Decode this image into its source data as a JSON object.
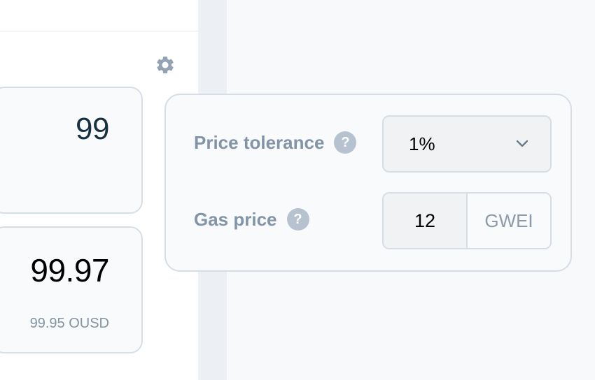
{
  "swap_form": {
    "settings_icon": "gear-icon",
    "input_amount": "99",
    "output_amount": "99.97",
    "output_min": "99.95 OUSD"
  },
  "settings": {
    "price_tolerance": {
      "label": "Price tolerance",
      "help_icon": "?",
      "selected": "1%"
    },
    "gas_price": {
      "label": "Gas price",
      "help_icon": "?",
      "value": "12",
      "unit": "GWEI"
    }
  },
  "colors": {
    "label": "#8394a8",
    "border": "#d6dde4",
    "help_badge": "#b6c2cf",
    "page_bg": "#f8f9fb"
  }
}
